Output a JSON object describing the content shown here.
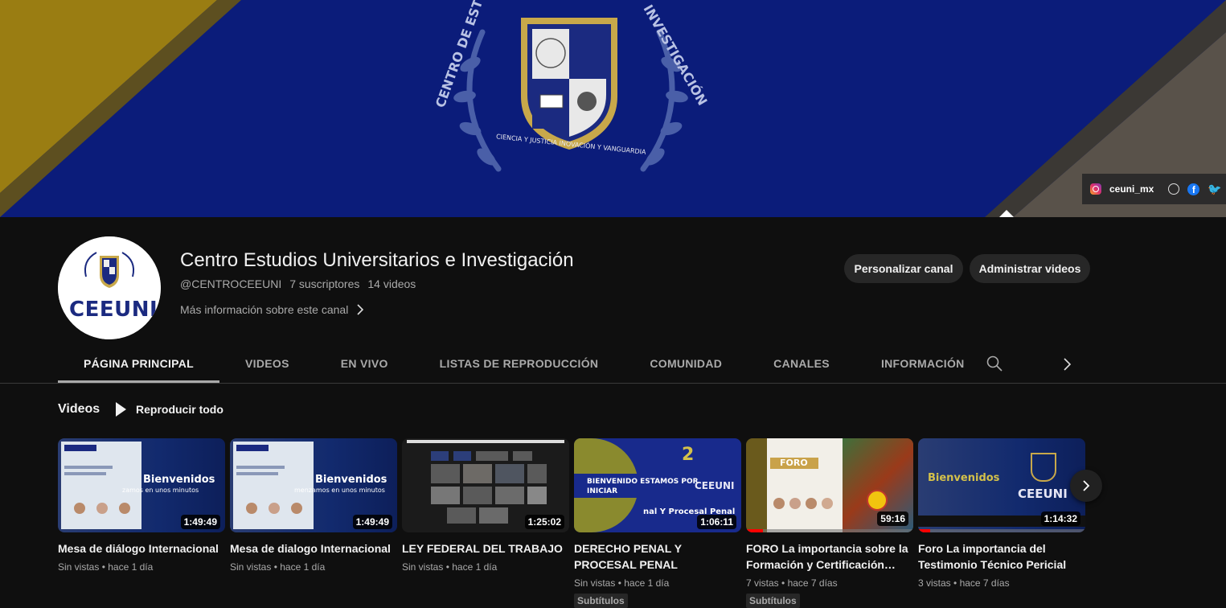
{
  "banner": {
    "logo_text_left": "CENTRO DE ESTUDIOS",
    "logo_text_right": "INVESTIGACIÓN",
    "motto": "CIENCIA Y JUSTICIA INOVACIÓN Y VANGUARDIA",
    "social": {
      "instagram": "ceuni_mx",
      "icons": [
        "instagram-icon",
        "globe-icon",
        "facebook-icon",
        "twitter-icon"
      ]
    },
    "colors": {
      "navy": "#0b1c7a",
      "gold": "#9a7d12",
      "gray": "#59524a"
    }
  },
  "channel": {
    "avatar_text": "CEEUNI",
    "title": "Centro Estudios Universitarios e Investigación",
    "handle": "@CENTROCEEUNI",
    "subscribers": "7 suscriptores",
    "videos_count": "14 videos",
    "more_info": "Más información sobre este canal",
    "buttons": {
      "customize": "Personalizar canal",
      "manage": "Administrar videos"
    }
  },
  "tabs": [
    {
      "label": "PÁGINA PRINCIPAL",
      "active": true
    },
    {
      "label": "VIDEOS"
    },
    {
      "label": "EN VIVO"
    },
    {
      "label": "LISTAS DE REPRODUCCIÓN"
    },
    {
      "label": "COMUNIDAD"
    },
    {
      "label": "CANALES"
    },
    {
      "label": "INFORMACIÓN"
    }
  ],
  "shelf": {
    "title": "Videos",
    "play_all": "Reproducir todo",
    "videos": [
      {
        "title": "Mesa de diálogo Internacional",
        "duration": "1:49:49",
        "views": "Sin vistas",
        "age": "hace 1 día",
        "thumb_text": "Bienvenidos",
        "thumb_sub": "zamos en unos minutos"
      },
      {
        "title": "Mesa de dialogo Internacional",
        "duration": "1:49:49",
        "views": "Sin vistas",
        "age": "hace 1 día",
        "thumb_text": "Bienvenidos",
        "thumb_sub": "menzamos en unos minutos"
      },
      {
        "title": "LEY FEDERAL DEL TRABAJO",
        "duration": "1:25:02",
        "views": "Sin vistas",
        "age": "hace 1 día"
      },
      {
        "title": "DERECHO PENAL Y PROCESAL PENAL",
        "duration": "1:06:11",
        "views": "Sin vistas",
        "age": "hace 1 día",
        "badge": "Subtítulos",
        "thumb_text": "BIENVENIDO ESTAMOS POR INICIAR",
        "thumb_sub": "nal Y Procesal Penal",
        "thumb_logo": "CEEUNI"
      },
      {
        "title": "FORO La importancia sobre la Formación y Certificación…",
        "duration": "59:16",
        "views": "7 vistas",
        "age": "hace 7 días",
        "badge": "Subtítulos",
        "thumb_text": "FORO",
        "progress": 0.1
      },
      {
        "title": "Foro La importancia del Testimonio Técnico Pericial",
        "duration": "1:14:32",
        "views": "3 vistas",
        "age": "hace 7 días",
        "thumb_text": "Bienvenidos",
        "thumb_logo": "CEEUNI",
        "progress": 0.07
      }
    ]
  }
}
